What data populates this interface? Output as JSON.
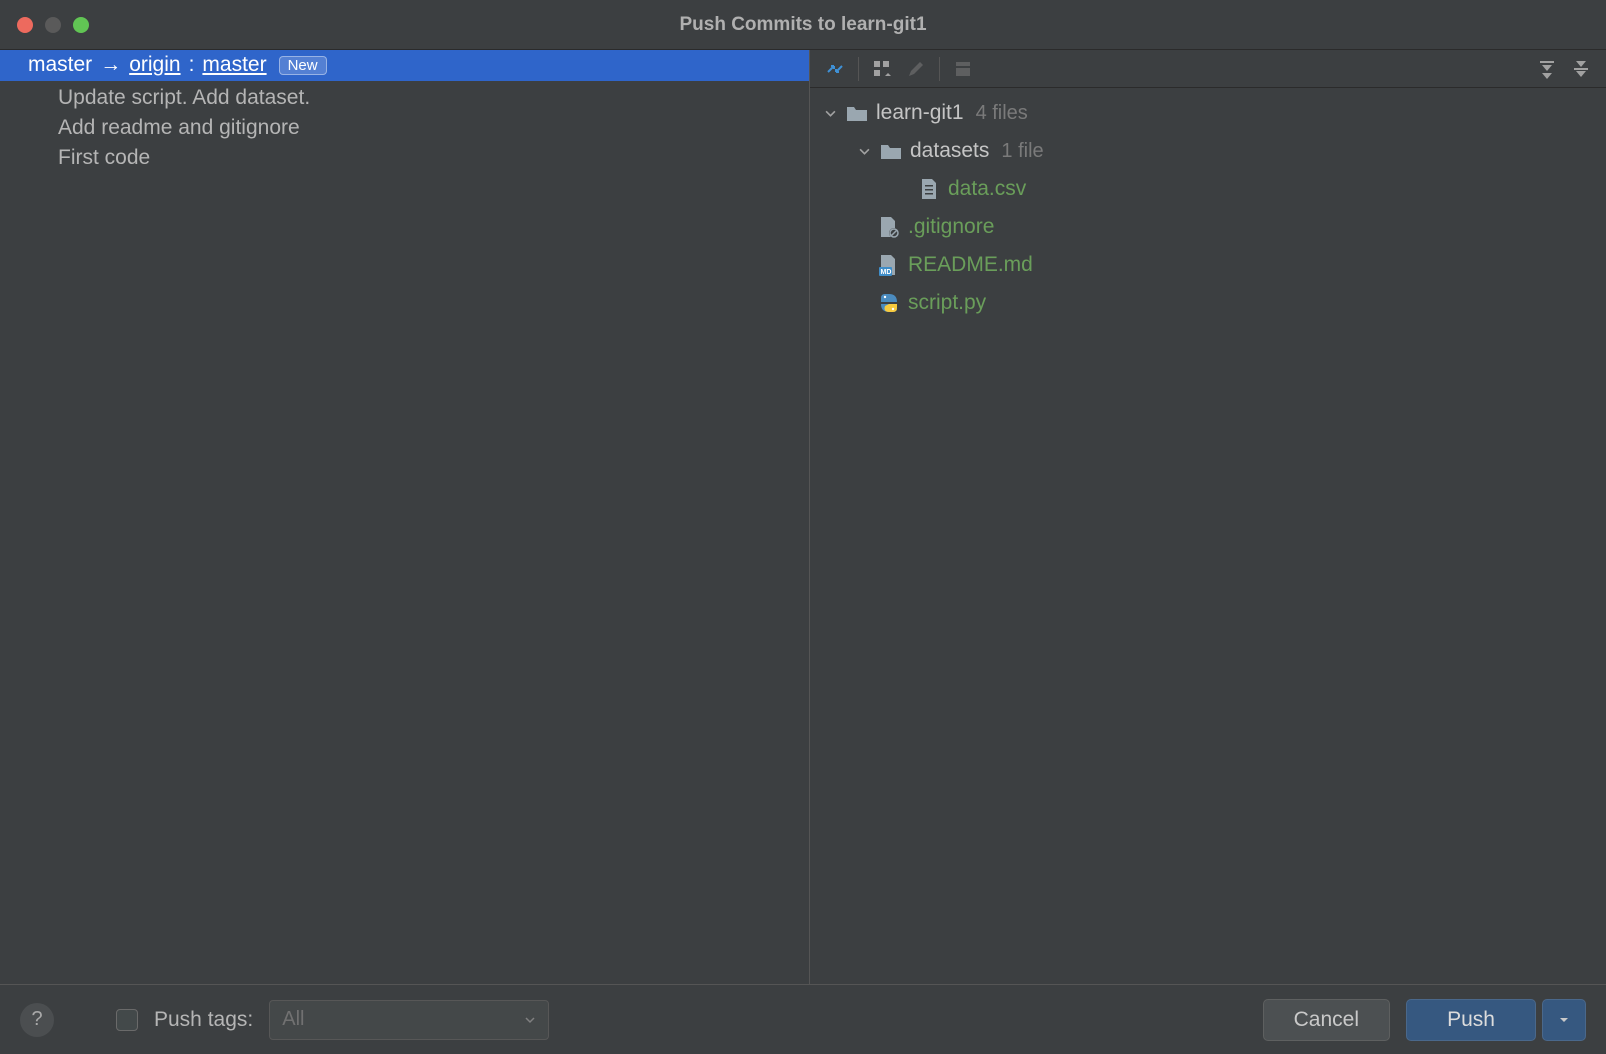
{
  "titlebar": {
    "title": "Push Commits to learn-git1"
  },
  "branch": {
    "local": "master",
    "arrow": "→",
    "remote": "origin",
    "colon": ":",
    "remote_branch": "master",
    "new_badge": "New"
  },
  "commits": [
    "Update script. Add dataset.",
    "Add readme and gitignore",
    "First code"
  ],
  "tree": {
    "root": {
      "name": "learn-git1",
      "count": "4 files"
    },
    "folders": [
      {
        "name": "datasets",
        "count": "1 file",
        "files": [
          "data.csv"
        ]
      }
    ],
    "root_files": [
      {
        "name": ".gitignore",
        "type": "txt"
      },
      {
        "name": "README.md",
        "type": "md"
      },
      {
        "name": "script.py",
        "type": "py"
      }
    ]
  },
  "footer": {
    "push_tags_label": "Push tags:",
    "combo_value": "All",
    "cancel": "Cancel",
    "push": "Push"
  }
}
